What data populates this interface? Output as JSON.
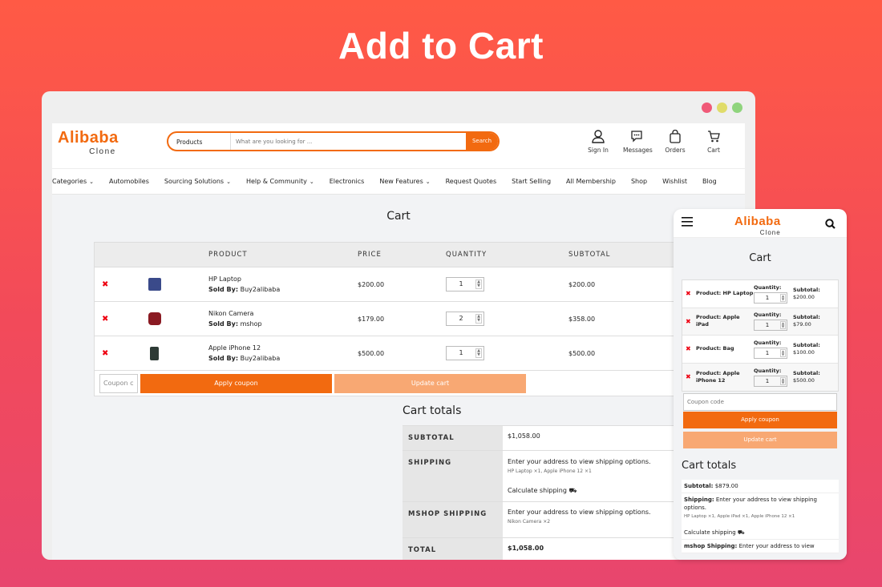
{
  "hero_title": "Add to Cart",
  "colors": {
    "accent": "#f26a10",
    "accent_light": "#f8a873",
    "remove": "#e01a1a",
    "dot_red": "#f05a78",
    "dot_yellow": "#e0dc6a",
    "dot_green": "#8fd47d"
  },
  "header": {
    "logo": "Alibaba",
    "logo_sub": "Clone",
    "search_category": "Products",
    "search_placeholder": "What are you looking for ...",
    "search_button": "Search",
    "icons": [
      {
        "label": "Sign In",
        "icon": "user-icon"
      },
      {
        "label": "Messages",
        "icon": "chat-icon"
      },
      {
        "label": "Orders",
        "icon": "bag-icon"
      },
      {
        "label": "Cart",
        "icon": "cart-icon"
      }
    ]
  },
  "nav": [
    "Categories",
    "Automobiles",
    "Sourcing Solutions",
    "Help & Community",
    "Electronics",
    "New Features",
    "Request Quotes",
    "Start Selling",
    "All Membership",
    "Shop",
    "Wishlist",
    "Blog"
  ],
  "cart": {
    "title": "Cart",
    "columns": {
      "product": "PRODUCT",
      "price": "PRICE",
      "quantity": "QUANTITY",
      "subtotal": "SUBTOTAL"
    },
    "sold_by_label": "Sold By:",
    "items": [
      {
        "name": "HP Laptop",
        "seller": "Buy2alibaba",
        "price": "$200.00",
        "qty": "1",
        "subtotal": "$200.00",
        "thumb": "#3a4a8a"
      },
      {
        "name": "Nikon Camera",
        "seller": "mshop",
        "price": "$179.00",
        "qty": "2",
        "subtotal": "$358.00",
        "thumb": "#8a1a22"
      },
      {
        "name": "Apple iPhone 12",
        "seller": "Buy2alibaba",
        "price": "$500.00",
        "qty": "1",
        "subtotal": "$500.00",
        "thumb": "#2d3a35"
      }
    ],
    "coupon_placeholder": "Coupon c",
    "apply_coupon": "Apply coupon",
    "update_cart": "Update cart"
  },
  "totals": {
    "title": "Cart totals",
    "subtotal_label": "SUBTOTAL",
    "subtotal": "$1,058.00",
    "shipping_label": "SHIPPING",
    "shipping_text": "Enter your address to view shipping options.",
    "shipping_items": "HP Laptop ×1, Apple iPhone 12 ×1",
    "calculate_shipping": "Calculate shipping",
    "mshop_label": "MSHOP SHIPPING",
    "mshop_text": "Enter your address to view shipping options.",
    "mshop_items": "Nikon Camera ×2",
    "total_label": "TOTAL",
    "total": "$1,058.00"
  },
  "mobile": {
    "logo": "Alibaba",
    "logo_sub": "Clone",
    "title": "Cart",
    "qty_label": "Quantity:",
    "subtotal_label": "Subtotal:",
    "items": [
      {
        "product": "Product: HP Laptop",
        "qty": "1",
        "subtotal": "$200.00"
      },
      {
        "product": "Product: Apple iPad",
        "qty": "1",
        "subtotal": "$79.00"
      },
      {
        "product": "Product: Bag",
        "qty": "1",
        "subtotal": "$100.00"
      },
      {
        "product": "Product: Apple iPhone 12",
        "qty": "1",
        "subtotal": "$500.00"
      }
    ],
    "coupon_placeholder": "Coupon code",
    "apply_coupon": "Apply coupon",
    "update_cart": "Update cart",
    "totals_title": "Cart totals",
    "subtotal_label2": "Subtotal:",
    "subtotal": "$879.00",
    "shipping_label": "Shipping:",
    "shipping_text": "Enter your address to view shipping options.",
    "shipping_items": "HP Laptop ×1, Apple iPad ×1, Apple iPhone 12 ×1",
    "calculate_shipping": "Calculate shipping",
    "mshop_label": "mshop Shipping:",
    "mshop_text": "Enter your address to view"
  }
}
